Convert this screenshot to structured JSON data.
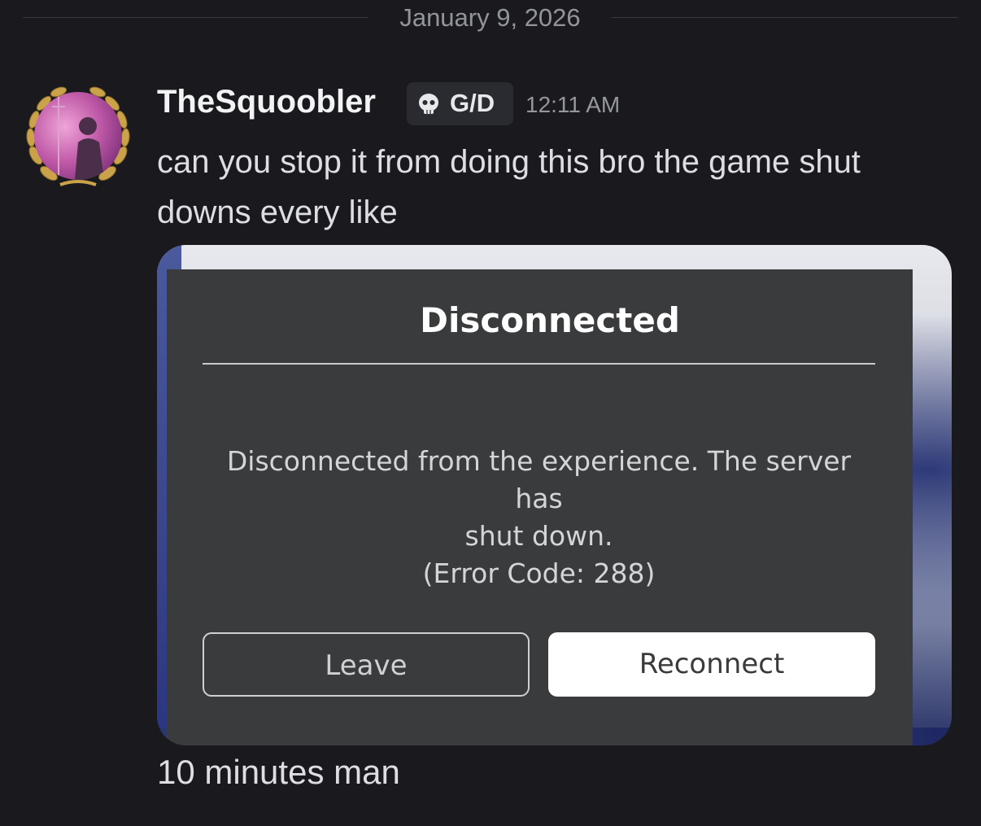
{
  "date_divider": "January 9, 2026",
  "message": {
    "author": "TheSquoobler",
    "tag": {
      "icon": "skull-icon",
      "label": "G/D"
    },
    "time": "12:11 AM",
    "text": "can you stop it from doing this bro the game shut downs every like",
    "avatar_icon": "laurel-wreath-avatar",
    "followup": "10 minutes man"
  },
  "dialog": {
    "title": "Disconnected",
    "body_line1": "Disconnected from the experience. The server has",
    "body_line2": "shut down.",
    "body_line3": "(Error Code: 288)",
    "leave_label": "Leave",
    "reconnect_label": "Reconnect"
  },
  "colors": {
    "background": "#1a1a1e",
    "dialog_bg": "#393b3d",
    "text": "#dcdee2"
  }
}
